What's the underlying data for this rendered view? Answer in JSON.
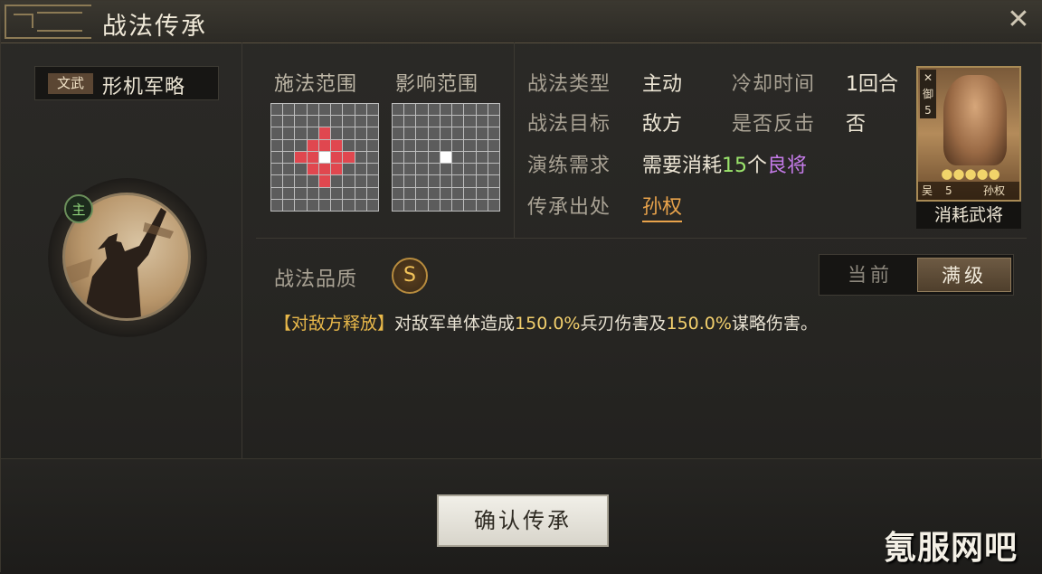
{
  "window": {
    "title": "战法传承"
  },
  "skill": {
    "type_badge": "文武",
    "name": "形机军略"
  },
  "portrait": {
    "main_badge": "主"
  },
  "range": {
    "cast_label": "施法范围",
    "effect_label": "影响范围"
  },
  "info": {
    "type_label": "战法类型",
    "type_value": "主动",
    "cooldown_label": "冷却时间",
    "cooldown_value": "1回合",
    "target_label": "战法目标",
    "target_value": "敌方",
    "counter_label": "是否反击",
    "counter_value": "否",
    "train_label": "演练需求",
    "train_prefix": "需要消耗",
    "train_count": "15",
    "train_unit": "个",
    "train_item": "良将",
    "source_label": "传承出处",
    "source_value": "孙权"
  },
  "general_card": {
    "type_glyph": "✕",
    "role": "御",
    "rank": "5",
    "stars": "●●●●●",
    "faction": "吴",
    "cost": "5",
    "name": "孙权",
    "caption": "消耗武将"
  },
  "quality": {
    "label": "战法品质",
    "grade": "S"
  },
  "level_toggle": {
    "current": "当前",
    "max": "满级",
    "selected": "满级"
  },
  "description": {
    "tag": "【对敌方释放】",
    "part1": "对敌军单体造成",
    "value1": "150.0%",
    "part2": "兵刃伤害及",
    "value2": "150.0%",
    "part3": "谋略伤害。"
  },
  "footer": {
    "confirm_label": "确认传承"
  },
  "watermark": "氪服网吧",
  "colors": {
    "accent_orange": "#e9a34b",
    "green": "#9be56c",
    "purple": "#c47be8",
    "range_red": "#e0474f"
  }
}
